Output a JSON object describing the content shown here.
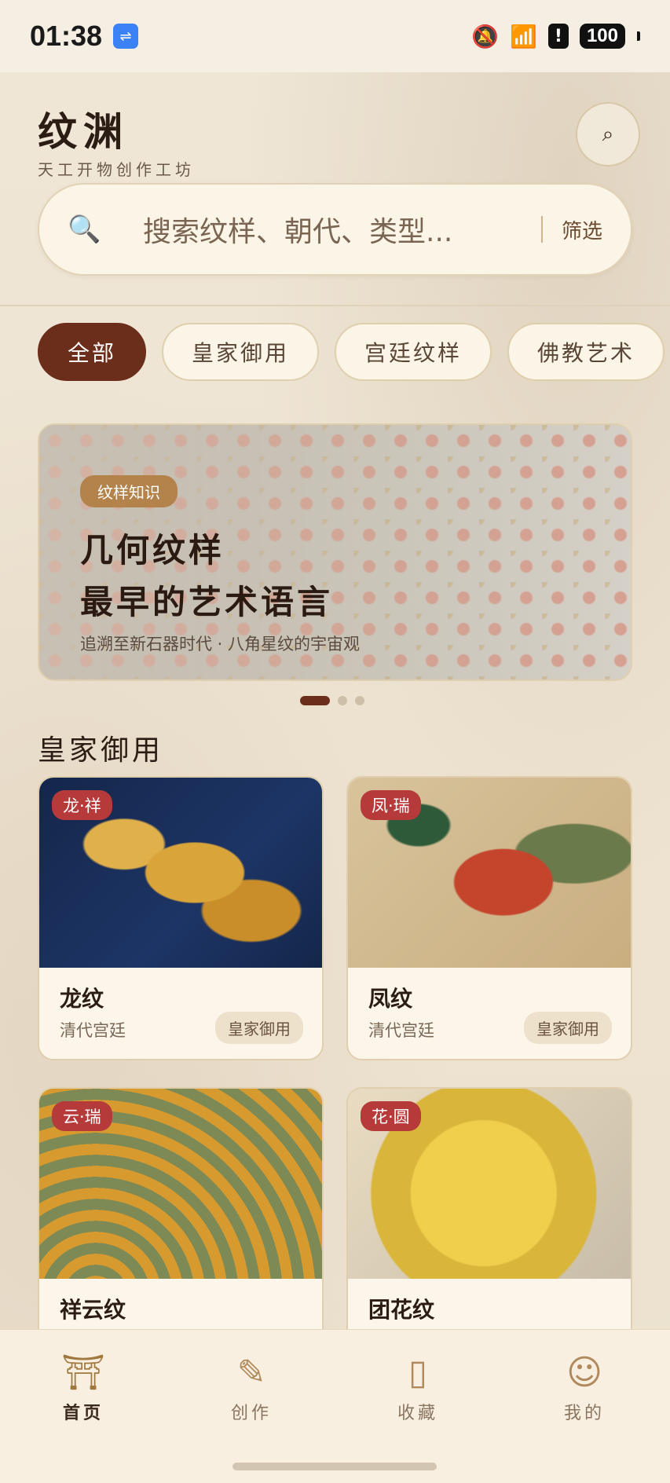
{
  "status_bar": {
    "time": "01:38",
    "battery": "100"
  },
  "header": {
    "title": "纹渊",
    "subtitle": "天工开物创作工坊"
  },
  "search": {
    "placeholder": "搜索纹样、朝代、类型...",
    "filter_label": "筛选"
  },
  "tabs": [
    {
      "label": "全部",
      "active": true
    },
    {
      "label": "皇家御用"
    },
    {
      "label": "宫廷纹样"
    },
    {
      "label": "佛教艺术"
    }
  ],
  "banner": {
    "tag": "纹样知识",
    "title_line1": "几何纹样",
    "title_line2": "最早的艺术语言",
    "subtitle": "追溯至新石器时代 · 八角星纹的宇宙观",
    "page_count": 3,
    "active_page": 1
  },
  "section": {
    "title": "皇家御用"
  },
  "cards": [
    {
      "tag": "龙·祥",
      "name": "龙纹",
      "era": "清代宫廷",
      "badge": "皇家御用",
      "image": "dragon-embroidery"
    },
    {
      "tag": "凤·瑞",
      "name": "凤纹",
      "era": "清代宫廷",
      "badge": "皇家御用",
      "image": "phoenix-embroidery"
    },
    {
      "tag": "云·瑞",
      "name": "祥云纹",
      "era": "",
      "badge": "",
      "image": "cloud-pattern"
    },
    {
      "tag": "花·圆",
      "name": "团花纹",
      "era": "",
      "badge": "",
      "image": "round-flower-pattern"
    }
  ],
  "bottom_nav": [
    {
      "label": "首页",
      "icon": "temple-icon",
      "active": true
    },
    {
      "label": "创作",
      "icon": "brush-icon"
    },
    {
      "label": "收藏",
      "icon": "book-icon"
    },
    {
      "label": "我的",
      "icon": "person-icon"
    }
  ],
  "colors": {
    "accent": "#6b2e1a",
    "tag_red": "#b63a3a",
    "background": "#efe6d6"
  }
}
